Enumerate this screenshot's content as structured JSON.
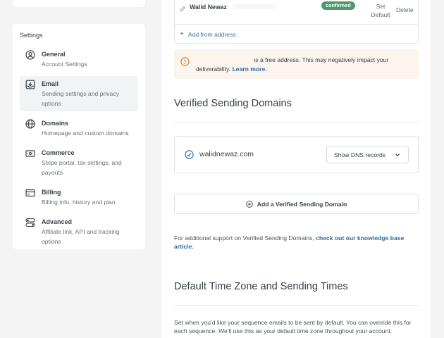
{
  "sidebar": {
    "heading": "Settings",
    "items": [
      {
        "title": "General",
        "sub": "Account Settings",
        "icon": "user-circle-icon"
      },
      {
        "title": "Email",
        "sub": "Sending settings and privacy options",
        "icon": "inbox-download-icon"
      },
      {
        "title": "Domains",
        "sub": "Homepage and custom domains",
        "icon": "globe-icon"
      },
      {
        "title": "Commerce",
        "sub": "Stripe portal, tax settings, and payouts",
        "icon": "cash-icon"
      },
      {
        "title": "Billing",
        "sub": "Billing info, history and plan",
        "icon": "credit-card-icon"
      },
      {
        "title": "Advanced",
        "sub": "Affiliate link, API and tracking options",
        "icon": "toggles-icon"
      }
    ]
  },
  "from_addresses": {
    "row": {
      "name": "Walid Newaz",
      "badge": "confirmed",
      "set_default": "Set Default",
      "delete": "Delete"
    },
    "add_label": "Add from address"
  },
  "warning": {
    "text": "is a free address. This may negatively impact your deliverability.",
    "link": "Learn more."
  },
  "verified_domains": {
    "title": "Verified Sending Domains",
    "domain": "walidnewaz.com",
    "dns_button": "Show DNS records",
    "add_button": "Add a Verified Sending Domain",
    "support_text": "For additional support on Verified Sending Domains,",
    "support_link": "check out our knowledge base article."
  },
  "timezone": {
    "title": "Default Time Zone and Sending Times",
    "text": "Set when you'd like your sequence emails to be sent by default. You can override this for each sequence. We'll use this as your default time zone throughout your account."
  },
  "colors": {
    "badge": "#4c9a6a",
    "link": "#2e6aa0",
    "warning_bg": "#fcf5ee",
    "warning_icon": "#d9802c"
  }
}
